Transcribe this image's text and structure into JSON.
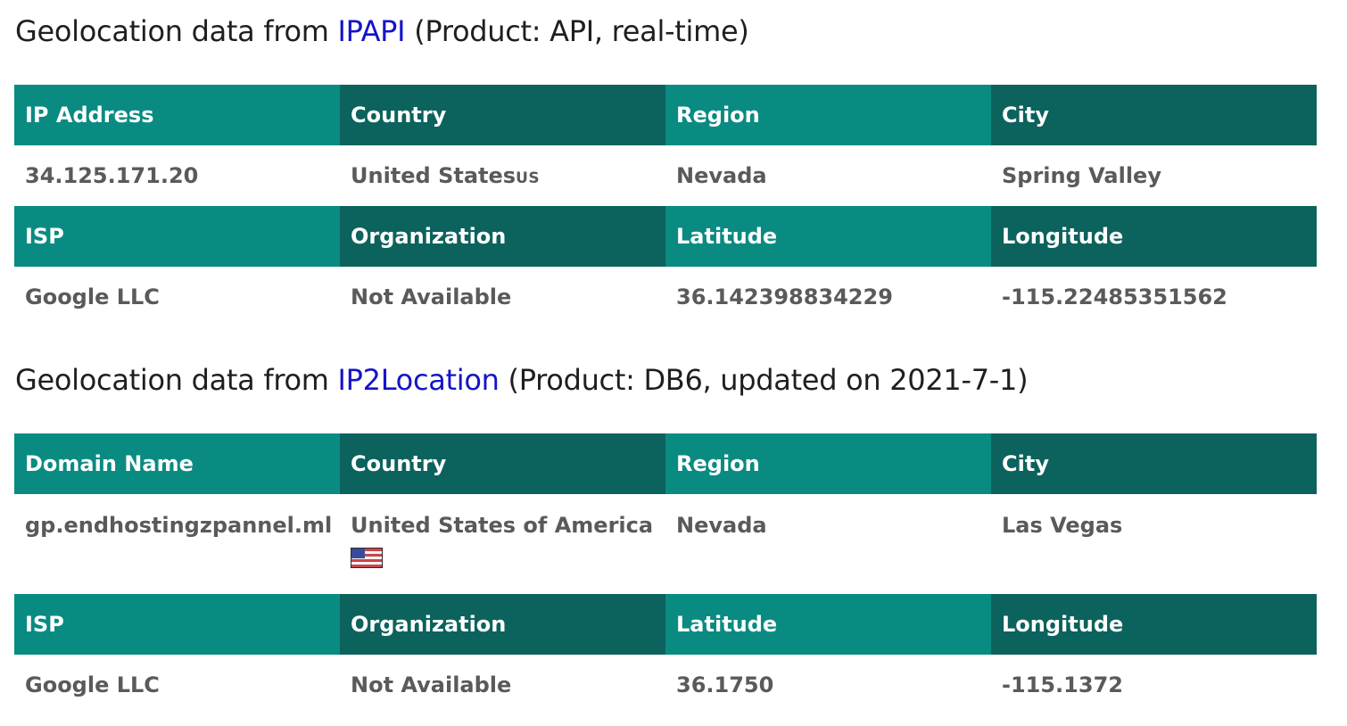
{
  "sections": [
    {
      "title_prefix": "Geolocation data from ",
      "source_link": "IPAPI",
      "title_suffix": " (Product: API, real-time)",
      "headers1": [
        "IP Address",
        "Country",
        "Region",
        "City"
      ],
      "values1": [
        "34.125.171.20",
        "United States",
        "Nevada",
        "Spring Valley"
      ],
      "country_code": "US",
      "headers2": [
        "ISP",
        "Organization",
        "Latitude",
        "Longitude"
      ],
      "values2": [
        "Google LLC",
        "Not Available",
        "36.142398834229",
        "-115.22485351562"
      ]
    },
    {
      "title_prefix": "Geolocation data from ",
      "source_link": "IP2Location",
      "title_suffix": " (Product: DB6, updated on 2021-7-1)",
      "headers1": [
        "Domain Name",
        "Country",
        "Region",
        "City"
      ],
      "values1": [
        "gp.endhostingzpannel.ml",
        "United States of America",
        "Nevada",
        "Las Vegas"
      ],
      "flag_icon": "us-flag-icon",
      "headers2": [
        "ISP",
        "Organization",
        "Latitude",
        "Longitude"
      ],
      "values2": [
        "Google LLC",
        "Not Available",
        "36.1750",
        "-115.1372"
      ]
    }
  ]
}
